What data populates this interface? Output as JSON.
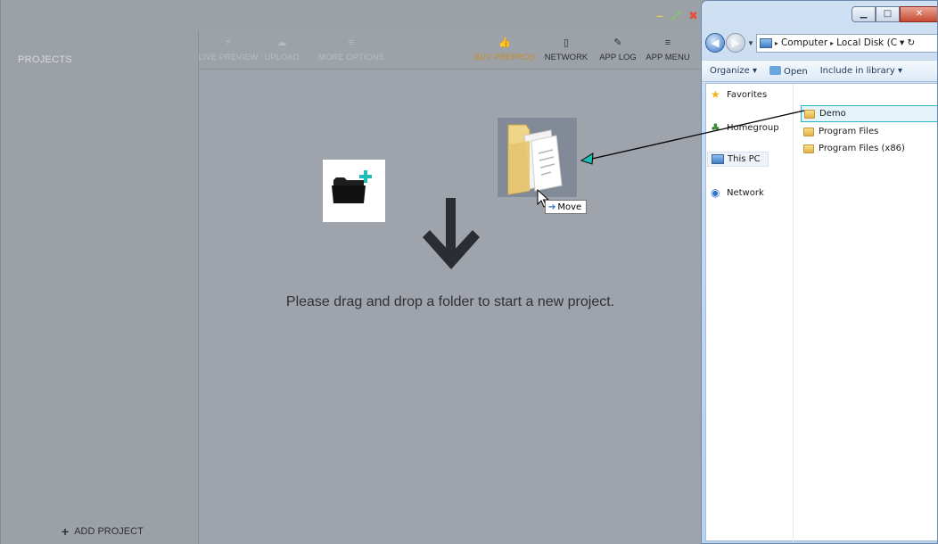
{
  "prepros": {
    "window_controls": {
      "minimize": "–",
      "maximize": "⤢",
      "close": "✖"
    },
    "sidebar": {
      "title": "PROJECTS",
      "add_project_icon": "+",
      "add_project_label": "ADD PROJECT"
    },
    "toolbar": {
      "live_preview": {
        "icon": "lightning-icon",
        "glyph": "⚡",
        "label": "LIVE PREVIEW"
      },
      "upload": {
        "icon": "cloud-upload-icon",
        "glyph": "☁",
        "label": "UPLOAD"
      },
      "more_options": {
        "icon": "list-icon",
        "glyph": "≡",
        "label": "MORE OPTIONS"
      },
      "buy": {
        "icon": "thumbs-up-icon",
        "glyph": "👍",
        "label": "BUY PREPROS"
      },
      "network": {
        "icon": "device-icon",
        "glyph": "▯",
        "label": "NETWORK"
      },
      "app_log": {
        "icon": "pen-icon",
        "glyph": "✎",
        "label": "APP LOG"
      },
      "app_menu": {
        "icon": "menu-icon",
        "glyph": "≡",
        "label": "APP MENU"
      }
    },
    "main": {
      "drop_message": "Please drag and drop a folder to start a new project."
    },
    "drag": {
      "tooltip": "Move",
      "tooltip_icon": "➔"
    }
  },
  "explorer": {
    "caption_buttons": {
      "minimize": "▁",
      "maximize": "□",
      "close": "✕"
    },
    "address": {
      "dropdown": "▼",
      "sep1": "▸",
      "sep2": "▸",
      "part1": "Computer",
      "part2": "Local Disk (C",
      "tail": "▾",
      "refresh": "↻"
    },
    "toolbar": {
      "organize": "Organize ▾",
      "open": "Open",
      "include": "Include in library ▾"
    },
    "nav": [
      {
        "label": "Favorites",
        "icon": "star-icon",
        "glyph": "★"
      },
      {
        "label": "Homegroup",
        "icon": "homegroup-icon",
        "glyph": "♣"
      },
      {
        "label": "This PC",
        "icon": "computer-icon",
        "glyph": ""
      },
      {
        "label": "Network",
        "icon": "network-icon",
        "glyph": "◉"
      }
    ],
    "files": [
      {
        "name": "Demo"
      },
      {
        "name": "Program Files"
      },
      {
        "name": "Program Files (x86)"
      }
    ]
  },
  "colors": {
    "app_background": "#9da2a9",
    "accent_teal": "#1fbfb8",
    "buy_accent": "#c48d2a",
    "close_red": "#e74c3c"
  }
}
